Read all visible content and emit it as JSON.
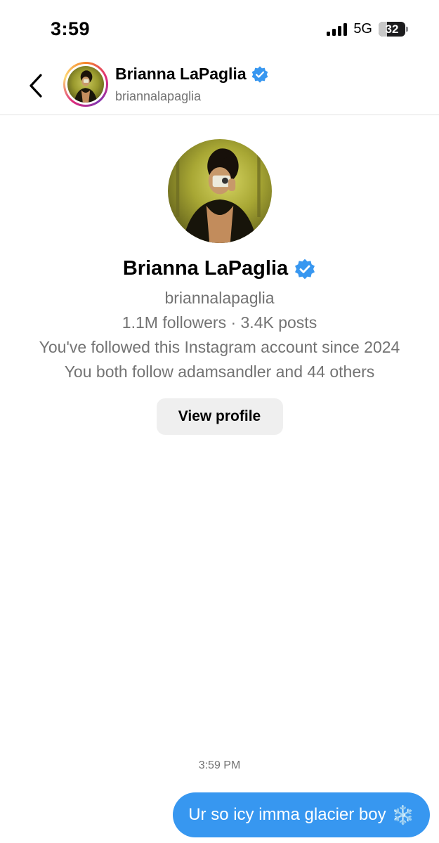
{
  "status_bar": {
    "time": "3:59",
    "network": "5G",
    "battery_percent": "32",
    "battery_level": 0.32
  },
  "header": {
    "name": "Brianna LaPaglia",
    "username": "briannalapaglia",
    "verified_icon": "verified-badge-icon",
    "back_icon": "chevron-left-icon"
  },
  "profile": {
    "name": "Brianna LaPaglia",
    "username": "briannalapaglia",
    "stats": "1.1M followers · 3.4K posts",
    "follow_since": "You've followed this Instagram account since 2024",
    "mutuals": "You both follow adamsandler and 44 others",
    "view_profile_label": "View profile"
  },
  "messages": {
    "timestamp": "3:59 PM",
    "items": [
      {
        "text": "Ur so icy imma glacier boy",
        "emoji": "❄️",
        "sender": "me"
      }
    ]
  },
  "colors": {
    "accent_blue": "#3797f0",
    "verified_blue": "#3897f0",
    "secondary_text": "#737373",
    "button_bg": "#efefef"
  }
}
